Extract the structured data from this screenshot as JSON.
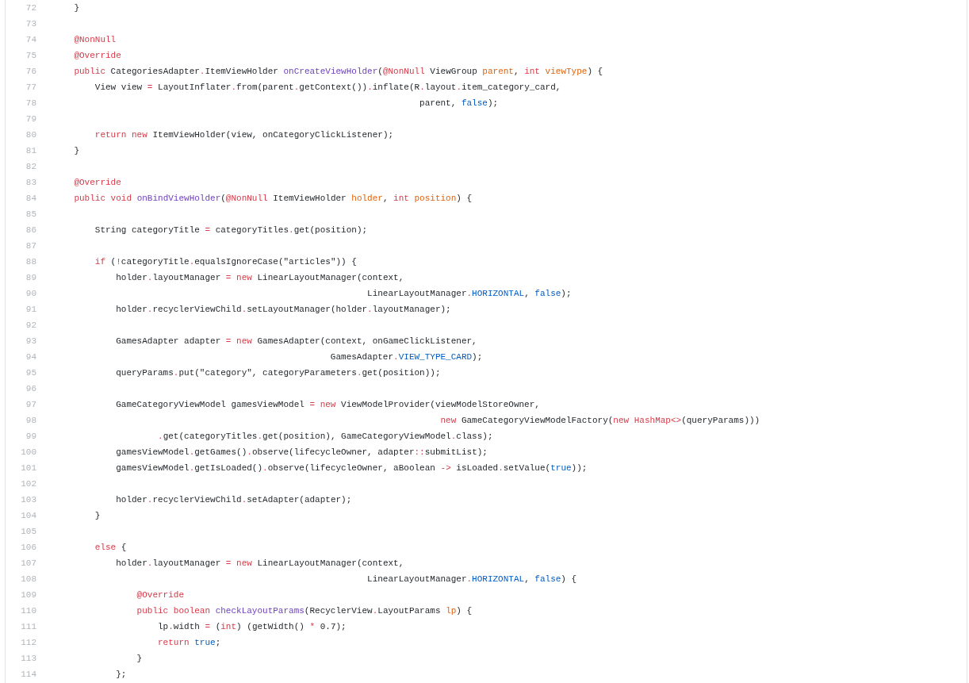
{
  "code_view": {
    "lines": [
      {
        "number": "72",
        "tokens": [
          {
            "kind": "plain",
            "text": "    }"
          }
        ]
      },
      {
        "number": "73"
      },
      {
        "number": "74",
        "tokens": [
          {
            "kind": "keyword",
            "text": "    @NonNull"
          }
        ]
      },
      {
        "number": "75",
        "tokens": [
          {
            "kind": "keyword",
            "text": "    @Override"
          }
        ]
      },
      {
        "number": "76",
        "tokens": [
          {
            "kind": "keyword",
            "text": "    public"
          },
          {
            "kind": "plain",
            "text": " CategoriesAdapter"
          },
          {
            "kind": "keyword",
            "text": "."
          },
          {
            "kind": "plain",
            "text": "ItemViewHolder "
          },
          {
            "kind": "function",
            "text": "onCreateViewHolder"
          },
          {
            "kind": "plain",
            "text": "("
          },
          {
            "kind": "keyword",
            "text": "@NonNull"
          },
          {
            "kind": "plain",
            "text": " ViewGroup "
          },
          {
            "kind": "parameter",
            "text": "parent"
          },
          {
            "kind": "plain",
            "text": ", "
          },
          {
            "kind": "keyword",
            "text": "int "
          },
          {
            "kind": "parameter",
            "text": "viewType"
          },
          {
            "kind": "plain",
            "text": ") {"
          }
        ]
      },
      {
        "number": "77",
        "tokens": [
          {
            "kind": "plain",
            "text": "        View view "
          },
          {
            "kind": "keyword",
            "text": "="
          },
          {
            "kind": "plain",
            "text": " LayoutInflater"
          },
          {
            "kind": "keyword",
            "text": "."
          },
          {
            "kind": "plain",
            "text": "from(parent"
          },
          {
            "kind": "keyword",
            "text": "."
          },
          {
            "kind": "plain",
            "text": "getContext())"
          },
          {
            "kind": "keyword",
            "text": "."
          },
          {
            "kind": "plain",
            "text": "inflate(R"
          },
          {
            "kind": "keyword",
            "text": "."
          },
          {
            "kind": "plain",
            "text": "layout"
          },
          {
            "kind": "keyword",
            "text": "."
          },
          {
            "kind": "plain",
            "text": "item_category_card,"
          }
        ]
      },
      {
        "number": "78",
        "tokens": [
          {
            "kind": "plain",
            "text": "                                                                      parent, "
          },
          {
            "kind": "constant",
            "text": "false"
          },
          {
            "kind": "plain",
            "text": ");"
          }
        ]
      },
      {
        "number": "79"
      },
      {
        "number": "80",
        "tokens": [
          {
            "kind": "keyword",
            "text": "        return new"
          },
          {
            "kind": "plain",
            "text": " ItemViewHolder(view, onCategoryClickListener);"
          }
        ]
      },
      {
        "number": "81",
        "tokens": [
          {
            "kind": "plain",
            "text": "    }"
          }
        ]
      },
      {
        "number": "82"
      },
      {
        "number": "83",
        "tokens": [
          {
            "kind": "keyword",
            "text": "    @Override"
          }
        ]
      },
      {
        "number": "84",
        "tokens": [
          {
            "kind": "keyword",
            "text": "    public void "
          },
          {
            "kind": "function",
            "text": "onBindViewHolder"
          },
          {
            "kind": "plain",
            "text": "("
          },
          {
            "kind": "keyword",
            "text": "@NonNull"
          },
          {
            "kind": "plain",
            "text": " ItemViewHolder "
          },
          {
            "kind": "parameter",
            "text": "holder"
          },
          {
            "kind": "plain",
            "text": ", "
          },
          {
            "kind": "keyword",
            "text": "int "
          },
          {
            "kind": "parameter",
            "text": "position"
          },
          {
            "kind": "plain",
            "text": ") {"
          }
        ]
      },
      {
        "number": "85"
      },
      {
        "number": "86",
        "tokens": [
          {
            "kind": "plain",
            "text": "        String categoryTitle "
          },
          {
            "kind": "keyword",
            "text": "="
          },
          {
            "kind": "plain",
            "text": " categoryTitles"
          },
          {
            "kind": "keyword",
            "text": "."
          },
          {
            "kind": "plain",
            "text": "get(position);"
          }
        ]
      },
      {
        "number": "87"
      },
      {
        "number": "88",
        "tokens": [
          {
            "kind": "keyword",
            "text": "        if"
          },
          {
            "kind": "plain",
            "text": " ("
          },
          {
            "kind": "keyword",
            "text": "!"
          },
          {
            "kind": "plain",
            "text": "categoryTitle"
          },
          {
            "kind": "keyword",
            "text": "."
          },
          {
            "kind": "plain",
            "text": "equalsIgnoreCase(\"articles\")) {"
          }
        ]
      },
      {
        "number": "89",
        "tokens": [
          {
            "kind": "plain",
            "text": "            holder"
          },
          {
            "kind": "keyword",
            "text": "."
          },
          {
            "kind": "plain",
            "text": "layoutManager "
          },
          {
            "kind": "keyword",
            "text": "= new"
          },
          {
            "kind": "plain",
            "text": " LinearLayoutManager(context,"
          }
        ]
      },
      {
        "number": "90",
        "tokens": [
          {
            "kind": "plain",
            "text": "                                                            LinearLayoutManager"
          },
          {
            "kind": "keyword",
            "text": "."
          },
          {
            "kind": "constant",
            "text": "HORIZONTAL"
          },
          {
            "kind": "plain",
            "text": ", "
          },
          {
            "kind": "constant",
            "text": "false"
          },
          {
            "kind": "plain",
            "text": ");"
          }
        ]
      },
      {
        "number": "91",
        "tokens": [
          {
            "kind": "plain",
            "text": "            holder"
          },
          {
            "kind": "keyword",
            "text": "."
          },
          {
            "kind": "plain",
            "text": "recyclerViewChild"
          },
          {
            "kind": "keyword",
            "text": "."
          },
          {
            "kind": "plain",
            "text": "setLayoutManager(holder"
          },
          {
            "kind": "keyword",
            "text": "."
          },
          {
            "kind": "plain",
            "text": "layoutManager);"
          }
        ]
      },
      {
        "number": "92"
      },
      {
        "number": "93",
        "tokens": [
          {
            "kind": "plain",
            "text": "            GamesAdapter adapter "
          },
          {
            "kind": "keyword",
            "text": "= new"
          },
          {
            "kind": "plain",
            "text": " GamesAdapter(context, onGameClickListener,"
          }
        ]
      },
      {
        "number": "94",
        "tokens": [
          {
            "kind": "plain",
            "text": "                                                     GamesAdapter"
          },
          {
            "kind": "keyword",
            "text": "."
          },
          {
            "kind": "constant",
            "text": "VIEW_TYPE_CARD"
          },
          {
            "kind": "plain",
            "text": ");"
          }
        ]
      },
      {
        "number": "95",
        "tokens": [
          {
            "kind": "plain",
            "text": "            queryParams"
          },
          {
            "kind": "keyword",
            "text": "."
          },
          {
            "kind": "plain",
            "text": "put(\"category\", categoryParameters"
          },
          {
            "kind": "keyword",
            "text": "."
          },
          {
            "kind": "plain",
            "text": "get(position));"
          }
        ]
      },
      {
        "number": "96"
      },
      {
        "number": "97",
        "tokens": [
          {
            "kind": "plain",
            "text": "            GameCategoryViewModel gamesViewModel "
          },
          {
            "kind": "keyword",
            "text": "= new"
          },
          {
            "kind": "plain",
            "text": " ViewModelProvider(viewModelStoreOwner,"
          }
        ]
      },
      {
        "number": "98",
        "tokens": [
          {
            "kind": "keyword",
            "text": "                                                                          new"
          },
          {
            "kind": "plain",
            "text": " GameCategoryViewModelFactory("
          },
          {
            "kind": "keyword",
            "text": "new HashMap<>"
          },
          {
            "kind": "plain",
            "text": "(queryParams)))"
          }
        ]
      },
      {
        "number": "99",
        "tokens": [
          {
            "kind": "keyword",
            "text": "                    ."
          },
          {
            "kind": "plain",
            "text": "get(categoryTitles"
          },
          {
            "kind": "keyword",
            "text": "."
          },
          {
            "kind": "plain",
            "text": "get(position), GameCategoryViewModel"
          },
          {
            "kind": "keyword",
            "text": "."
          },
          {
            "kind": "plain",
            "text": "class);"
          }
        ]
      },
      {
        "number": "100",
        "tokens": [
          {
            "kind": "plain",
            "text": "            gamesViewModel"
          },
          {
            "kind": "keyword",
            "text": "."
          },
          {
            "kind": "plain",
            "text": "getGames()"
          },
          {
            "kind": "keyword",
            "text": "."
          },
          {
            "kind": "plain",
            "text": "observe(lifecycleOwner, adapter"
          },
          {
            "kind": "keyword",
            "text": "::"
          },
          {
            "kind": "plain",
            "text": "submitList);"
          }
        ]
      },
      {
        "number": "101",
        "tokens": [
          {
            "kind": "plain",
            "text": "            gamesViewModel"
          },
          {
            "kind": "keyword",
            "text": "."
          },
          {
            "kind": "plain",
            "text": "getIsLoaded()"
          },
          {
            "kind": "keyword",
            "text": "."
          },
          {
            "kind": "plain",
            "text": "observe(lifecycleOwner, aBoolean "
          },
          {
            "kind": "keyword",
            "text": "->"
          },
          {
            "kind": "plain",
            "text": " isLoaded"
          },
          {
            "kind": "keyword",
            "text": "."
          },
          {
            "kind": "plain",
            "text": "setValue("
          },
          {
            "kind": "constant",
            "text": "true"
          },
          {
            "kind": "plain",
            "text": "));"
          }
        ]
      },
      {
        "number": "102"
      },
      {
        "number": "103",
        "tokens": [
          {
            "kind": "plain",
            "text": "            holder"
          },
          {
            "kind": "keyword",
            "text": "."
          },
          {
            "kind": "plain",
            "text": "recyclerViewChild"
          },
          {
            "kind": "keyword",
            "text": "."
          },
          {
            "kind": "plain",
            "text": "setAdapter(adapter);"
          }
        ]
      },
      {
        "number": "104",
        "tokens": [
          {
            "kind": "plain",
            "text": "        }"
          }
        ]
      },
      {
        "number": "105"
      },
      {
        "number": "106",
        "tokens": [
          {
            "kind": "keyword",
            "text": "        else"
          },
          {
            "kind": "plain",
            "text": " {"
          }
        ]
      },
      {
        "number": "107",
        "tokens": [
          {
            "kind": "plain",
            "text": "            holder"
          },
          {
            "kind": "keyword",
            "text": "."
          },
          {
            "kind": "plain",
            "text": "layoutManager "
          },
          {
            "kind": "keyword",
            "text": "= new"
          },
          {
            "kind": "plain",
            "text": " LinearLayoutManager(context,"
          }
        ]
      },
      {
        "number": "108",
        "tokens": [
          {
            "kind": "plain",
            "text": "                                                            LinearLayoutManager"
          },
          {
            "kind": "keyword",
            "text": "."
          },
          {
            "kind": "constant",
            "text": "HORIZONTAL"
          },
          {
            "kind": "plain",
            "text": ", "
          },
          {
            "kind": "constant",
            "text": "false"
          },
          {
            "kind": "plain",
            "text": ") {"
          }
        ]
      },
      {
        "number": "109",
        "tokens": [
          {
            "kind": "keyword",
            "text": "                @Override"
          }
        ]
      },
      {
        "number": "110",
        "tokens": [
          {
            "kind": "keyword",
            "text": "                public boolean "
          },
          {
            "kind": "function",
            "text": "checkLayoutParams"
          },
          {
            "kind": "plain",
            "text": "(RecyclerView"
          },
          {
            "kind": "keyword",
            "text": "."
          },
          {
            "kind": "plain",
            "text": "LayoutParams "
          },
          {
            "kind": "parameter",
            "text": "lp"
          },
          {
            "kind": "plain",
            "text": ") {"
          }
        ]
      },
      {
        "number": "111",
        "tokens": [
          {
            "kind": "plain",
            "text": "                    lp"
          },
          {
            "kind": "keyword",
            "text": "."
          },
          {
            "kind": "plain",
            "text": "width "
          },
          {
            "kind": "keyword",
            "text": "="
          },
          {
            "kind": "plain",
            "text": " ("
          },
          {
            "kind": "keyword",
            "text": "int"
          },
          {
            "kind": "plain",
            "text": ") (getWidth() "
          },
          {
            "kind": "keyword",
            "text": "*"
          },
          {
            "kind": "plain",
            "text": " 0.7);"
          }
        ]
      },
      {
        "number": "112",
        "tokens": [
          {
            "kind": "keyword",
            "text": "                    return "
          },
          {
            "kind": "constant",
            "text": "true"
          },
          {
            "kind": "plain",
            "text": ";"
          }
        ]
      },
      {
        "number": "113",
        "tokens": [
          {
            "kind": "plain",
            "text": "                }"
          }
        ]
      },
      {
        "number": "114",
        "tokens": [
          {
            "kind": "plain",
            "text": "            };"
          }
        ]
      }
    ]
  }
}
